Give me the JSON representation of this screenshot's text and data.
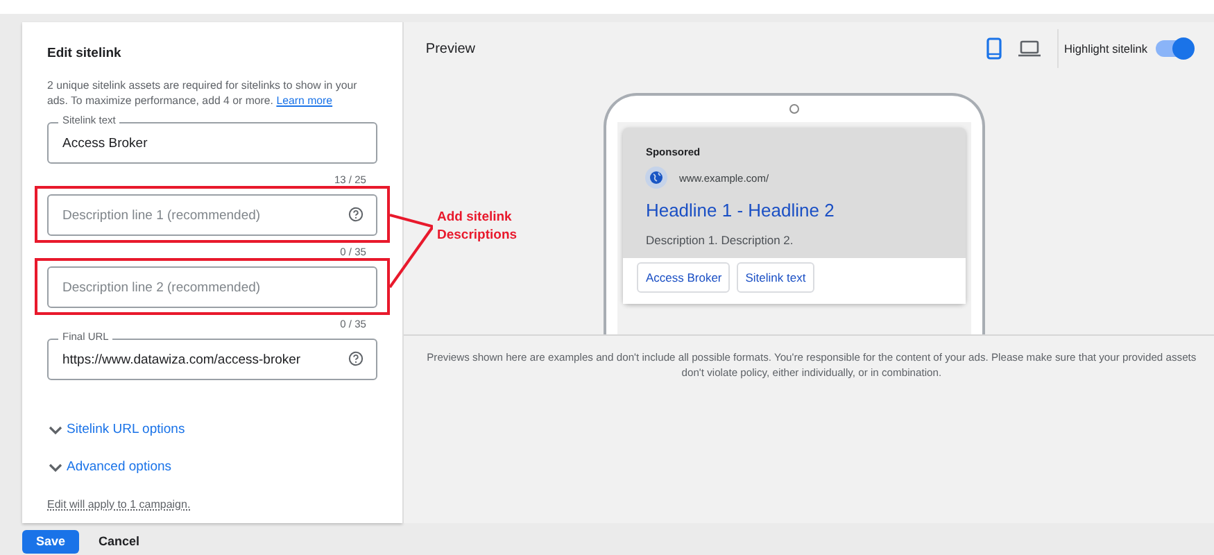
{
  "panel": {
    "title": "Edit sitelink",
    "intro": "2 unique sitelink assets are required for sitelinks to show in your ads. To maximize performance, add 4 or more.",
    "learn_more": "Learn more",
    "fields": [
      {
        "label": "Sitelink text",
        "value": "Access Broker",
        "counter": "13 / 25",
        "help": false,
        "highlighted": false
      },
      {
        "placeholder": "Description line 1 (recommended)",
        "counter": "0 / 35",
        "help": true,
        "highlighted": true
      },
      {
        "placeholder": "Description line 2 (recommended)",
        "counter": "0 / 35",
        "help": false,
        "highlighted": true
      },
      {
        "label": "Final URL",
        "value": "https://www.datawiza.com/access-broker",
        "help": true,
        "highlighted": false
      }
    ],
    "expanders": [
      {
        "label": "Sitelink URL options",
        "expanded": false
      },
      {
        "label": "Advanced options",
        "expanded": false
      }
    ],
    "note": "Edit will apply to 1 campaign."
  },
  "annotation": {
    "text": "Add sitelink Descriptions"
  },
  "preview": {
    "title": "Preview",
    "devices": [
      {
        "kind": "mobile",
        "selected": true
      },
      {
        "kind": "desktop",
        "selected": false
      }
    ],
    "highlight": {
      "label": "Highlight sitelink",
      "on": true
    },
    "ad": {
      "sponsored": "Sponsored",
      "url": "www.example.com/",
      "headline": "Headline 1 - Headline 2",
      "description": "Description 1. Description 2.",
      "sitelinks": [
        "Access Broker",
        "Sitelink text"
      ]
    },
    "disclaimer": "Previews shown here are examples and don't include all possible formats. You're responsible for the content of your ads. Please make sure that your provided assets don't violate policy, either individually, or in combination."
  },
  "footer": {
    "buttons": [
      {
        "label": "Save",
        "kind": "primary"
      },
      {
        "label": "Cancel",
        "kind": "text"
      }
    ]
  }
}
